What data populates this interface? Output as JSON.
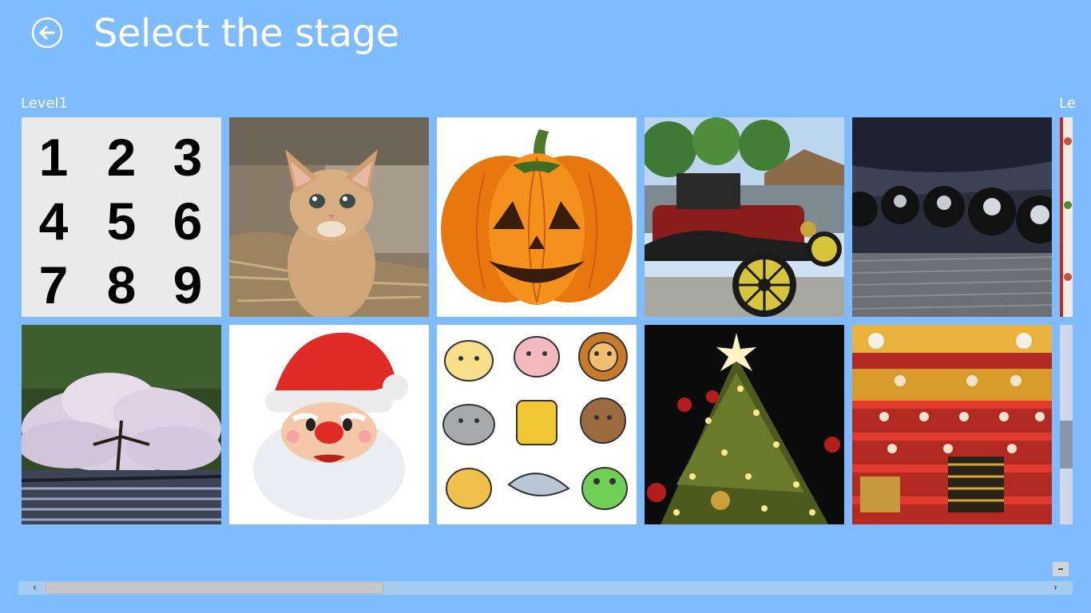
{
  "header": {
    "back_icon": "back-arrow-icon",
    "title": "Select the stage"
  },
  "groups": [
    {
      "label": "Level1",
      "stages": [
        {
          "name": "numbers",
          "numbers": [
            "1",
            "2",
            "3",
            "4",
            "5",
            "6",
            "7",
            "8",
            "9"
          ]
        },
        {
          "name": "kitten"
        },
        {
          "name": "jack-o-lantern"
        },
        {
          "name": "vintage-car"
        },
        {
          "name": "amplifier-knobs"
        },
        {
          "name": "cherry-blossom"
        },
        {
          "name": "santa-claus"
        },
        {
          "name": "cartoon-animals"
        },
        {
          "name": "christmas-tree"
        },
        {
          "name": "hina-dolls"
        }
      ]
    },
    {
      "label": "Le",
      "stages": [
        {
          "name": "partial-tile-1"
        },
        {
          "name": "partial-tile-2"
        }
      ]
    }
  ],
  "scrollbar": {
    "left_arrow": "‹",
    "right_arrow": "›",
    "position": 0.0
  },
  "zoom": {
    "label": "–"
  },
  "colors": {
    "background": "#7fbcff",
    "tile_numbers_bg": "#eaeaea"
  }
}
